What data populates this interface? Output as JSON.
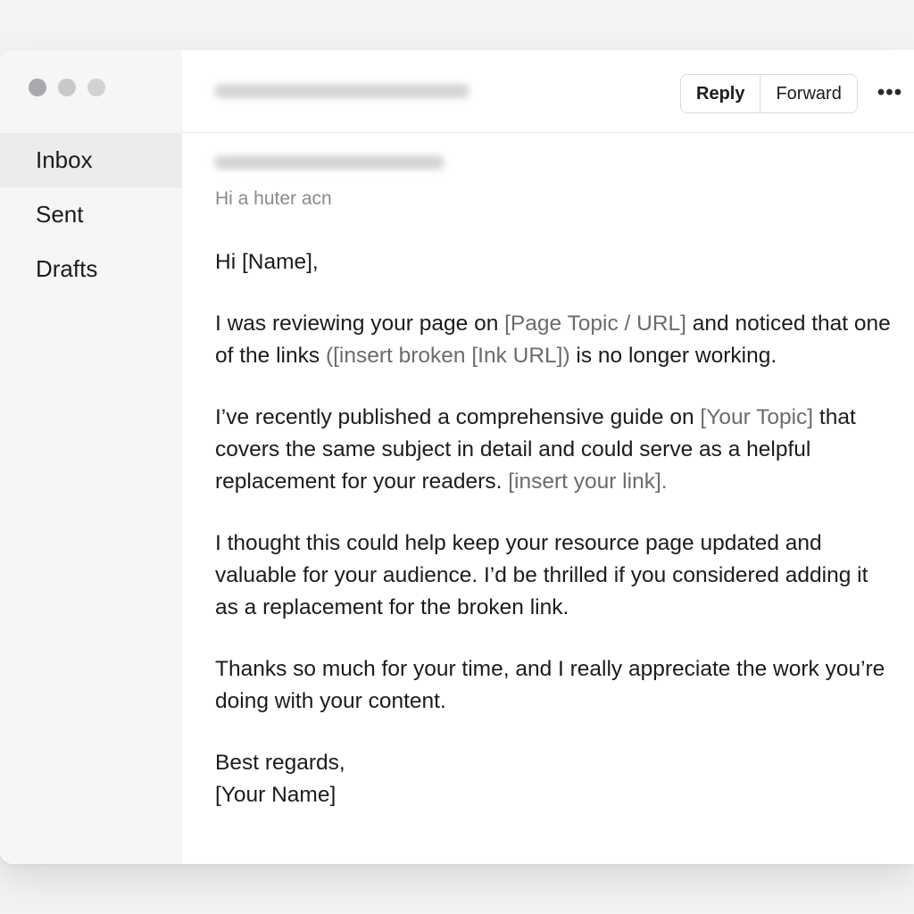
{
  "sidebar": {
    "window_controls": [
      "close",
      "minimize",
      "zoom"
    ],
    "items": [
      {
        "label": "Inbox",
        "active": true
      },
      {
        "label": "Sent",
        "active": false
      },
      {
        "label": "Drafts",
        "active": false
      }
    ]
  },
  "toolbar": {
    "reply_label": "Reply",
    "forward_label": "Forward",
    "more_label": "•••"
  },
  "message": {
    "snippet": "Hi a huter acn",
    "greeting": "Hi [Name],",
    "p1": {
      "a": "I was reviewing your page on ",
      "b": "[Page Topic / URL]",
      "c": " and noticed that one of the links ",
      "d": "([insert broken [Ink URL])",
      "e": " is no longer working."
    },
    "p2": {
      "a": "I’ve recently published a comprehensive guide on ",
      "b": "[Your Topic]",
      "c": " that covers the same subject in detail and could serve as a helpful replacement for your readers. ",
      "d": "[insert your link]."
    },
    "p3": "I thought this could help keep your resource page updated and valuable for your audience. I’d be thrilled if you considered adding it as a replacement for the broken link.",
    "p4": "Thanks so much for your time, and I really appreciate the work you’re doing with your content.",
    "signoff": "Best regards,",
    "signature": "[Your Name]"
  },
  "colors": {
    "placeholder_text": "#6b6b70",
    "sidebar_active": "#ececee"
  }
}
